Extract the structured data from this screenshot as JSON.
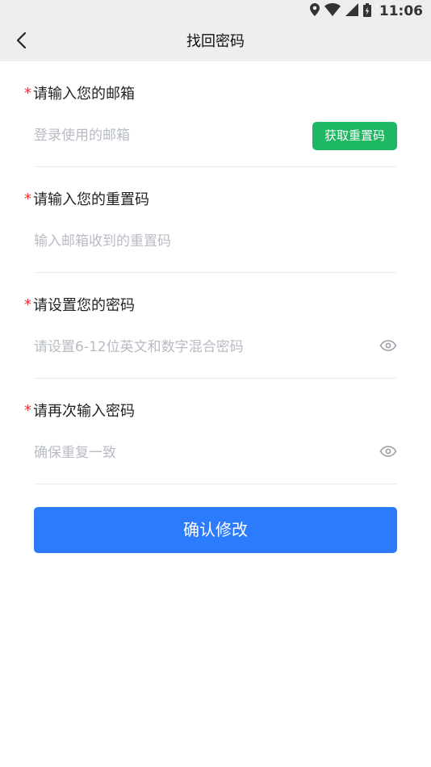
{
  "status_bar": {
    "time": "11:06"
  },
  "header": {
    "title": "找回密码"
  },
  "form": {
    "email": {
      "label": "请输入您的邮箱",
      "required_mark": "*",
      "placeholder": "登录使用的邮箱",
      "value": ""
    },
    "get_code_button": "获取重置码",
    "reset_code": {
      "label": "请输入您的重置码",
      "required_mark": "*",
      "placeholder": "输入邮箱收到的重置码",
      "value": ""
    },
    "password": {
      "label": "请设置您的密码",
      "required_mark": "*",
      "placeholder": "请设置6-12位英文和数字混合密码",
      "value": ""
    },
    "confirm_password": {
      "label": "请再次输入密码",
      "required_mark": "*",
      "placeholder": "确保重复一致",
      "value": ""
    },
    "submit_button": "确认修改"
  },
  "colors": {
    "primary": "#2b7bfc",
    "success": "#1fb862",
    "required": "#f23030",
    "placeholder": "#b8bcc4",
    "header_bg": "#eeeeee"
  },
  "icons": {
    "back": "chevron-left-icon",
    "location": "location-pin-icon",
    "wifi": "wifi-icon",
    "signal": "cell-signal-icon",
    "battery": "battery-icon",
    "toggle_visibility": "eye-icon"
  }
}
